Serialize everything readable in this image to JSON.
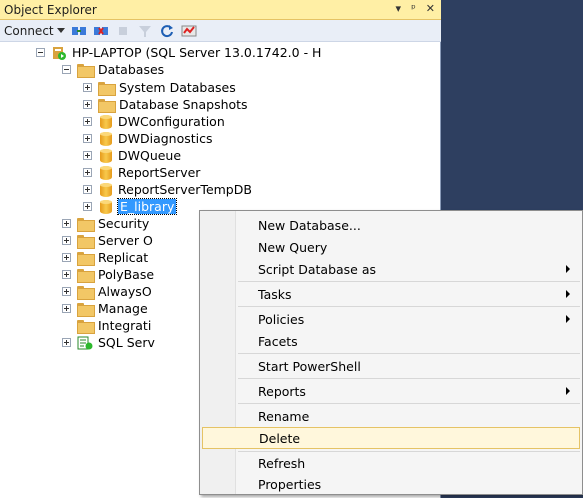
{
  "panel": {
    "title": "Object Explorer",
    "controls": [
      "▾",
      "ᵖ",
      "✕"
    ]
  },
  "toolbar": {
    "connect_label": "Connect"
  },
  "tree": {
    "server": "HP-LAPTOP (SQL Server 13.0.1742.0 - H",
    "databases": "Databases",
    "items": [
      "System Databases",
      "Database Snapshots",
      "DWConfiguration",
      "DWDiagnostics",
      "DWQueue",
      "ReportServer",
      "ReportServerTempDB",
      "E_library"
    ],
    "top_level": [
      "Security",
      "Server O",
      "Replicat",
      "PolyBase",
      "AlwaysO",
      "Manage",
      "Integrati",
      "SQL Serv"
    ]
  },
  "context_menu": {
    "items": [
      {
        "label": "New Database..."
      },
      {
        "label": "New Query"
      },
      {
        "label": "Script Database as",
        "submenu": true
      },
      {
        "label": "Tasks",
        "submenu": true
      },
      {
        "label": "Policies",
        "submenu": true
      },
      {
        "label": "Facets"
      },
      {
        "label": "Start PowerShell"
      },
      {
        "label": "Reports",
        "submenu": true
      },
      {
        "label": "Rename"
      },
      {
        "label": "Delete",
        "hover": true
      },
      {
        "label": "Refresh"
      },
      {
        "label": "Properties"
      }
    ]
  },
  "colors": {
    "title_bar": "#ffefa5",
    "selection": "#3399ff",
    "hover_border": "#e5c365"
  }
}
